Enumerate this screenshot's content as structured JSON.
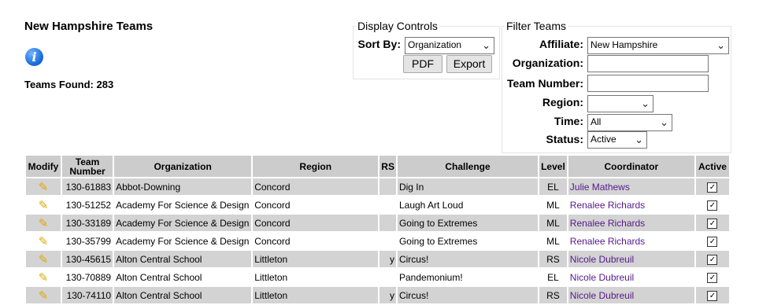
{
  "header": {
    "title": "New Hampshire Teams",
    "found_label": "Teams Found: 283"
  },
  "display_controls": {
    "legend": "Display Controls",
    "sort_label": "Sort By:",
    "sort_value": "Organization",
    "pdf": "PDF",
    "export": "Export"
  },
  "filter": {
    "legend": "Filter Teams",
    "affiliate_label": "Affiliate:",
    "affiliate_value": "New Hampshire",
    "org_label": "Organization:",
    "team_label": "Team Number:",
    "region_label": "Region:",
    "region_value": "",
    "time_label": "Time:",
    "time_value": "All",
    "status_label": "Status:",
    "status_value": "Active"
  },
  "table": {
    "headers": [
      "Modify",
      "Team Number",
      "Organization",
      "Region",
      "RS",
      "Challenge",
      "Level",
      "Coordinator",
      "Active"
    ],
    "rows": [
      {
        "team": "130-61883",
        "org": "Abbot-Downing",
        "region": "Concord",
        "rs": "",
        "challenge": "Dig In",
        "level": "EL",
        "coord": "Julie Mathews"
      },
      {
        "team": "130-51252",
        "org": "Academy For Science & Design",
        "region": "Concord",
        "rs": "",
        "challenge": "Laugh Art Loud",
        "level": "ML",
        "coord": "Renalee Richards"
      },
      {
        "team": "130-33189",
        "org": "Academy For Science & Design",
        "region": "Concord",
        "rs": "",
        "challenge": "Going to Extremes",
        "level": "ML",
        "coord": "Renalee Richards"
      },
      {
        "team": "130-35799",
        "org": "Academy For Science & Design",
        "region": "Concord",
        "rs": "",
        "challenge": "Going to Extremes",
        "level": "ML",
        "coord": "Renalee Richards"
      },
      {
        "team": "130-45615",
        "org": "Alton Central School",
        "region": "Littleton",
        "rs": "y",
        "challenge": "Circus!",
        "level": "RS",
        "coord": "Nicole Dubreuil"
      },
      {
        "team": "130-70889",
        "org": "Alton Central School",
        "region": "Littleton",
        "rs": "",
        "challenge": "Pandemonium!",
        "level": "EL",
        "coord": "Nicole Dubreuil"
      },
      {
        "team": "130-74110",
        "org": "Alton Central School",
        "region": "Littleton",
        "rs": "y",
        "challenge": "Circus!",
        "level": "RS",
        "coord": "Nicole Dubreuil"
      }
    ]
  }
}
